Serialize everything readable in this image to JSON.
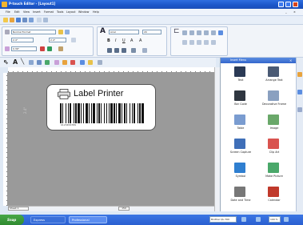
{
  "window": {
    "title": "P-touch Editor - [Layout1]",
    "controls": [
      "minimize",
      "maximize",
      "close"
    ]
  },
  "menubar": {
    "items": [
      "File",
      "Edit",
      "View",
      "Insert",
      "Format",
      "Tools",
      "Layout",
      "Window",
      "Help"
    ]
  },
  "property": {
    "format": "Normal Format",
    "width_value": "2.4\"",
    "length_value": "2.4\"",
    "font": "Arial",
    "font_size": "20",
    "margin_value": "0.39\""
  },
  "canvas": {
    "side_label": "2.4\"",
    "label_text": "Label Printer",
    "barcode_number": "0123456789",
    "sheet_tab": "Sheet 1",
    "zoom_value": "150"
  },
  "sidebar": {
    "title": "Insert Menu",
    "close": "×",
    "tools": [
      {
        "label": "Text",
        "icon": "text-icon"
      },
      {
        "label": "Arrange Text",
        "icon": "arrange-text-icon"
      },
      {
        "label": "Bar Code",
        "icon": "barcode-icon"
      },
      {
        "label": "Decorative Frame",
        "icon": "frame-icon"
      },
      {
        "label": "Table",
        "icon": "table-icon"
      },
      {
        "label": "Image",
        "icon": "image-icon"
      },
      {
        "label": "Screen Capture",
        "icon": "screen-capture-icon"
      },
      {
        "label": "Clip Art",
        "icon": "clip-art-icon"
      },
      {
        "label": "Symbol",
        "icon": "symbol-icon"
      },
      {
        "label": "Make Picture",
        "icon": "make-picture-icon"
      },
      {
        "label": "Date and Time",
        "icon": "clock-icon"
      },
      {
        "label": "Calendar",
        "icon": "calendar-icon"
      }
    ]
  },
  "taskbar": {
    "start": "Snap",
    "tasks": [
      "Express",
      "Professional"
    ],
    "printer": "Brother QL-700",
    "zoom": "100 %"
  },
  "colors": {
    "titlebar": "#2f6fe0",
    "taskbar": "#3b76e4",
    "canvas": "#9a9a9a",
    "start": "#3a9a3a"
  }
}
